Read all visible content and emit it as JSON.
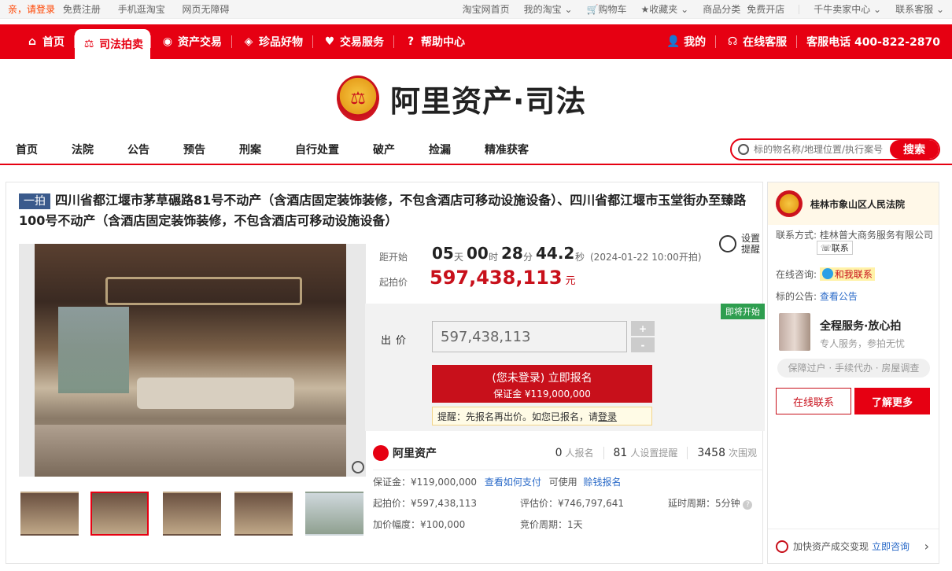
{
  "site_bar": {
    "greeting": "亲，请登录",
    "register": "免费注册",
    "mobile": "手机逛淘宝",
    "accessible": "网页无障碍",
    "home": "淘宝网首页",
    "my_taobao": "我的淘宝",
    "cart": "购物车",
    "favorites": "收藏夹",
    "categories": "商品分类",
    "open_shop": "免费开店",
    "seller_center": "千牛卖家中心",
    "support": "联系客服"
  },
  "topnav": {
    "items": [
      {
        "label": "首页",
        "icon": "home-icon"
      },
      {
        "label": "司法拍卖",
        "icon": "gavel-icon"
      },
      {
        "label": "资产交易",
        "icon": "asset-icon"
      },
      {
        "label": "珍品好物",
        "icon": "gem-icon"
      },
      {
        "label": "交易服务",
        "icon": "heart-icon"
      },
      {
        "label": "帮助中心",
        "icon": "help-icon"
      }
    ],
    "mine": "我的",
    "online_service": "在线客服",
    "hotline": "客服电话 400-822-2870"
  },
  "logo": {
    "text": "阿里资产·司法"
  },
  "catnav": [
    "首页",
    "法院",
    "公告",
    "预告",
    "刑案",
    "自行处置",
    "破产",
    "捡漏",
    "精准获客"
  ],
  "search": {
    "placeholder": "标的物名称/地理位置/执行案号",
    "button": "搜索"
  },
  "item": {
    "tag": "一拍",
    "title": "四川省都江堰市茅草碾路81号不动产（含酒店固定装饰装修，不包含酒店可移动设施设备）、四川省都江堰市玉堂街办至臻路100号不动产（含酒店固定装饰装修，不包含酒店可移动设施设备）"
  },
  "countdown": {
    "label": "距开始",
    "days": "05",
    "days_unit": "天",
    "hours": "00",
    "hours_unit": "时",
    "minutes": "28",
    "minutes_unit": "分",
    "seconds": "44.2",
    "seconds_unit": "秒",
    "note": "(2024-01-22 10:00开拍)",
    "remind": "设置提醒"
  },
  "start_price": {
    "label": "起拍价",
    "value": "597,438,113",
    "unit": "元"
  },
  "bid": {
    "soon": "即将开始",
    "label": "出价",
    "value": "597,438,113",
    "plus": "+",
    "minus": "-",
    "signup_line1": "(您未登录) 立即报名",
    "signup_line2": "保证金 ¥119,000,000",
    "hint": "提醒：先报名再出价。如您已报名，请",
    "hint_login": "登录"
  },
  "stats": {
    "brand": "阿里资产",
    "signups": "0",
    "signups_label": "人报名",
    "reminders": "81",
    "reminders_label": "人设置提醒",
    "views": "3458",
    "views_label": "次围观"
  },
  "details": {
    "deposit": "保证金：¥119,000,000",
    "how_pay": "查看如何支付",
    "usable": "可使用",
    "credit": "赊钱报名",
    "start": "起拍价：¥597,438,113",
    "assess": "评估价：¥746,797,641",
    "delay": "延时周期：5分钟",
    "increment": "加价幅度：¥100,000",
    "cycle": "竞价周期：1天"
  },
  "side": {
    "court": "桂林市象山区人民法院",
    "contact_label": "联系方式:",
    "contact_value": "桂林普大商务服务有限公司",
    "contact_btn": "联系",
    "consult_label": "在线咨询:",
    "consult_btn": "和我联系",
    "notice_label": "标的公告:",
    "notice_link": "查看公告",
    "service_title": "全程服务·放心拍",
    "service_sub": "专人服务，参拍无忧",
    "pill": "保障过户 · 手续代办 · 房屋调查",
    "online": "在线联系",
    "more": "了解更多",
    "foot_text": "加快资产成交变现",
    "foot_link": "立即咨询"
  }
}
